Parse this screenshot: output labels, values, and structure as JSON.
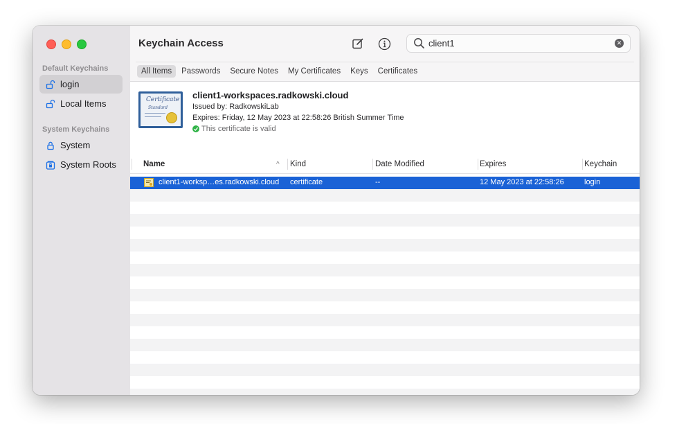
{
  "app": {
    "title": "Keychain Access"
  },
  "sidebar": {
    "default_section": "Default Keychains",
    "default_items": [
      {
        "label": "login",
        "icon": "unlocked-padlock-icon",
        "selected": true
      },
      {
        "label": "Local Items",
        "icon": "unlocked-padlock-icon",
        "selected": false
      }
    ],
    "system_section": "System Keychains",
    "system_items": [
      {
        "label": "System",
        "icon": "locked-padlock-icon"
      },
      {
        "label": "System Roots",
        "icon": "locked-cabinet-icon"
      }
    ]
  },
  "toolbar": {
    "new_item_icon": "compose-icon",
    "info_icon": "info-icon"
  },
  "search": {
    "value": "client1",
    "icon": "magnifier-icon",
    "clear_icon": "clear-icon"
  },
  "tabs": [
    "All Items",
    "Passwords",
    "Secure Notes",
    "My Certificates",
    "Keys",
    "Certificates"
  ],
  "active_tab": "All Items",
  "detail": {
    "name": "client1-workspaces.radkowski.cloud",
    "issued_by": "Issued by: RadkowskiLab",
    "expires": "Expires: Friday, 12 May 2023 at 22:58:26 British Summer Time",
    "status": "This certificate is valid",
    "cert_image_text_1": "Certificate",
    "cert_image_text_2": "Standard"
  },
  "table": {
    "columns": [
      "Name",
      "Kind",
      "Date Modified",
      "Expires",
      "Keychain"
    ],
    "sort_column": "Name",
    "sort_direction": "ascending",
    "rows": [
      {
        "name": "client1-worksp…es.radkowski.cloud",
        "kind": "certificate",
        "date_modified": "--",
        "expires": "12 May 2023 at 22:58:26",
        "keychain": "login",
        "selected": true
      }
    ]
  },
  "colors": {
    "selection_blue": "#1a62d6",
    "sidebar_bg": "#e5e3e6",
    "valid_green": "#31b348"
  }
}
